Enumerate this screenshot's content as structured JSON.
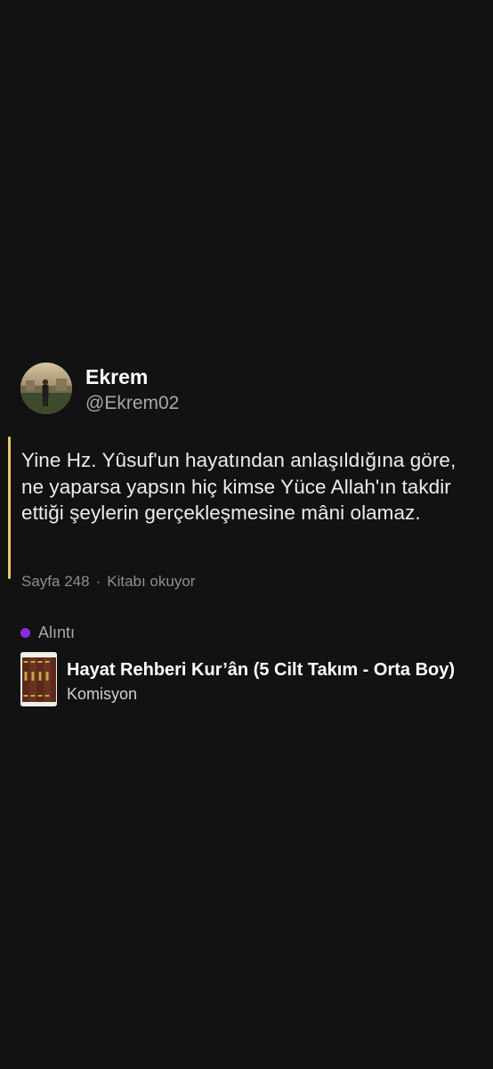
{
  "author": {
    "name": "Ekrem",
    "handle": "@Ekrem02",
    "avatar_icon": "profile-photo"
  },
  "quote": {
    "text": "Yine Hz. Yûsuf'un hayatından anlaşıldığına göre, ne yaparsa yapsın hiç kimse Yüce Allah'ın takdir ettiği şeylerin gerçekleşmesine mâni olamaz.",
    "page": "Sayfa 248",
    "separator": "·",
    "status": "Kitabı okuyor",
    "accent_color": "#e8c66a"
  },
  "post_type": {
    "label": "Alıntı",
    "dot_color": "#8a2be2"
  },
  "book": {
    "title": "Hayat Rehberi Kur’ân (5 Cilt Takım - Orta Boy)",
    "author": "Komisyon",
    "cover_icon": "book-cover"
  }
}
